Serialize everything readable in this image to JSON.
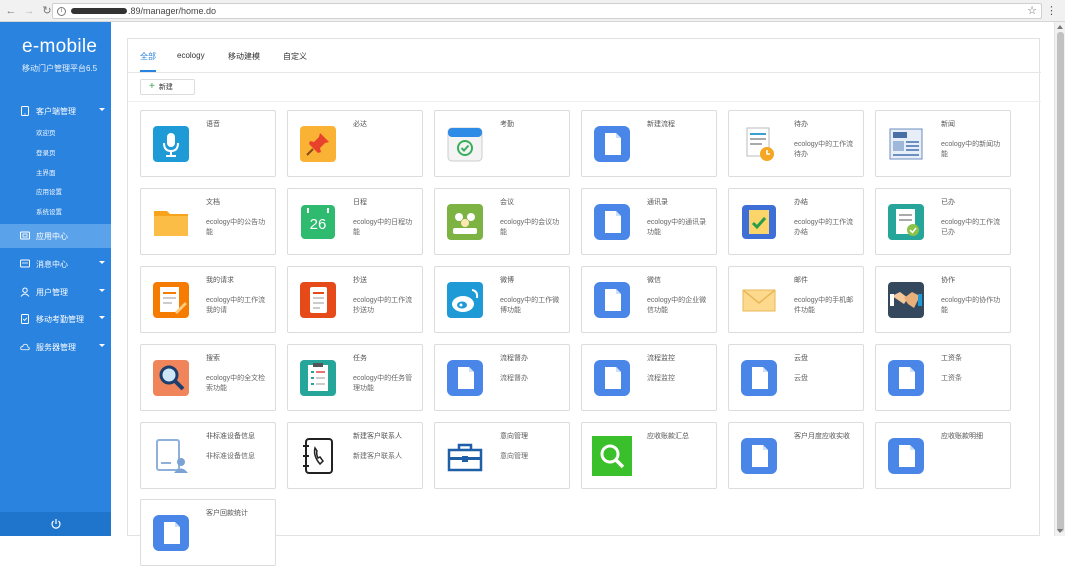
{
  "browser": {
    "url_tail": ".89/manager/home.do"
  },
  "sidebar": {
    "brand": "e-mobile",
    "subtitle": "移动门户管理平台6.5",
    "items": [
      {
        "label": "客户端管理",
        "icon": "phone-icon",
        "expanded": true
      },
      {
        "label": "应用中心",
        "icon": "app-grid-icon",
        "active": true
      },
      {
        "label": "消息中心",
        "icon": "message-icon"
      },
      {
        "label": "用户管理",
        "icon": "user-icon"
      },
      {
        "label": "移动考勤管理",
        "icon": "attendance-icon"
      },
      {
        "label": "服务器管理",
        "icon": "cloud-icon"
      }
    ],
    "subitems": [
      "欢迎页",
      "登录页",
      "主界面",
      "应用设置",
      "系统设置"
    ]
  },
  "tabs": [
    "全部",
    "ecology",
    "移动建模",
    "自定义"
  ],
  "add_button": "新建",
  "cards": [
    {
      "title": "语音",
      "desc": "",
      "icon": "microphone-icon"
    },
    {
      "title": "必达",
      "desc": "",
      "icon": "pushpin-icon"
    },
    {
      "title": "考勤",
      "desc": "",
      "icon": "calendar-check-icon"
    },
    {
      "title": "新建流程",
      "desc": "",
      "icon": "document-icon"
    },
    {
      "title": "待办",
      "desc": "ecology中的工作流待办",
      "icon": "todo-clock-icon"
    },
    {
      "title": "新闻",
      "desc": "ecology中的新闻功能",
      "icon": "newspaper-icon"
    },
    {
      "title": "文档",
      "desc": "ecology中的公告功能",
      "icon": "folder-icon"
    },
    {
      "title": "日程",
      "desc": "ecology中的日程功能",
      "icon": "calendar-26-icon"
    },
    {
      "title": "会议",
      "desc": "ecology中的会议功能",
      "icon": "meeting-icon"
    },
    {
      "title": "通讯录",
      "desc": "ecology中的通讯录功能",
      "icon": "document-icon"
    },
    {
      "title": "办结",
      "desc": "ecology中的工作流办结",
      "icon": "completed-task-icon"
    },
    {
      "title": "已办",
      "desc": "ecology中的工作流已办",
      "icon": "done-doc-icon"
    },
    {
      "title": "我的请求",
      "desc": "ecology中的工作流我的请",
      "icon": "request-doc-icon"
    },
    {
      "title": "抄送",
      "desc": "ecology中的工作流抄送功",
      "icon": "cc-doc-icon"
    },
    {
      "title": "微博",
      "desc": "ecology中的工作微博功能",
      "icon": "weibo-icon"
    },
    {
      "title": "微信",
      "desc": "ecology中的企业微信功能",
      "icon": "document-icon"
    },
    {
      "title": "邮件",
      "desc": "ecology中的手机邮件功能",
      "icon": "mail-icon"
    },
    {
      "title": "协作",
      "desc": "ecology中的协作功能",
      "icon": "handshake-icon"
    },
    {
      "title": "搜索",
      "desc": "ecology中的全文检索功能",
      "icon": "search-icon"
    },
    {
      "title": "任务",
      "desc": "ecology中的任务管理功能",
      "icon": "task-list-icon"
    },
    {
      "title": "流程督办",
      "desc": "流程督办",
      "icon": "document-icon"
    },
    {
      "title": "流程监控",
      "desc": "流程监控",
      "icon": "document-icon"
    },
    {
      "title": "云盘",
      "desc": "云盘",
      "icon": "document-icon"
    },
    {
      "title": "工资条",
      "desc": "工资条",
      "icon": "document-icon"
    },
    {
      "title": "非标准设备信息",
      "desc": "非标准设备信息",
      "icon": "tablet-user-icon"
    },
    {
      "title": "新建客户联系人",
      "desc": "新建客户联系人",
      "icon": "contact-book-icon"
    },
    {
      "title": "意向管理",
      "desc": "意向管理",
      "icon": "toolbox-icon"
    },
    {
      "title": "应收账款汇总",
      "desc": "",
      "icon": "green-search-icon"
    },
    {
      "title": "客户月度应收实收",
      "desc": "",
      "icon": "document-icon"
    },
    {
      "title": "应收账款明细",
      "desc": "",
      "icon": "document-icon"
    },
    {
      "title": "客户回款统计",
      "desc": "",
      "icon": "document-icon"
    }
  ]
}
